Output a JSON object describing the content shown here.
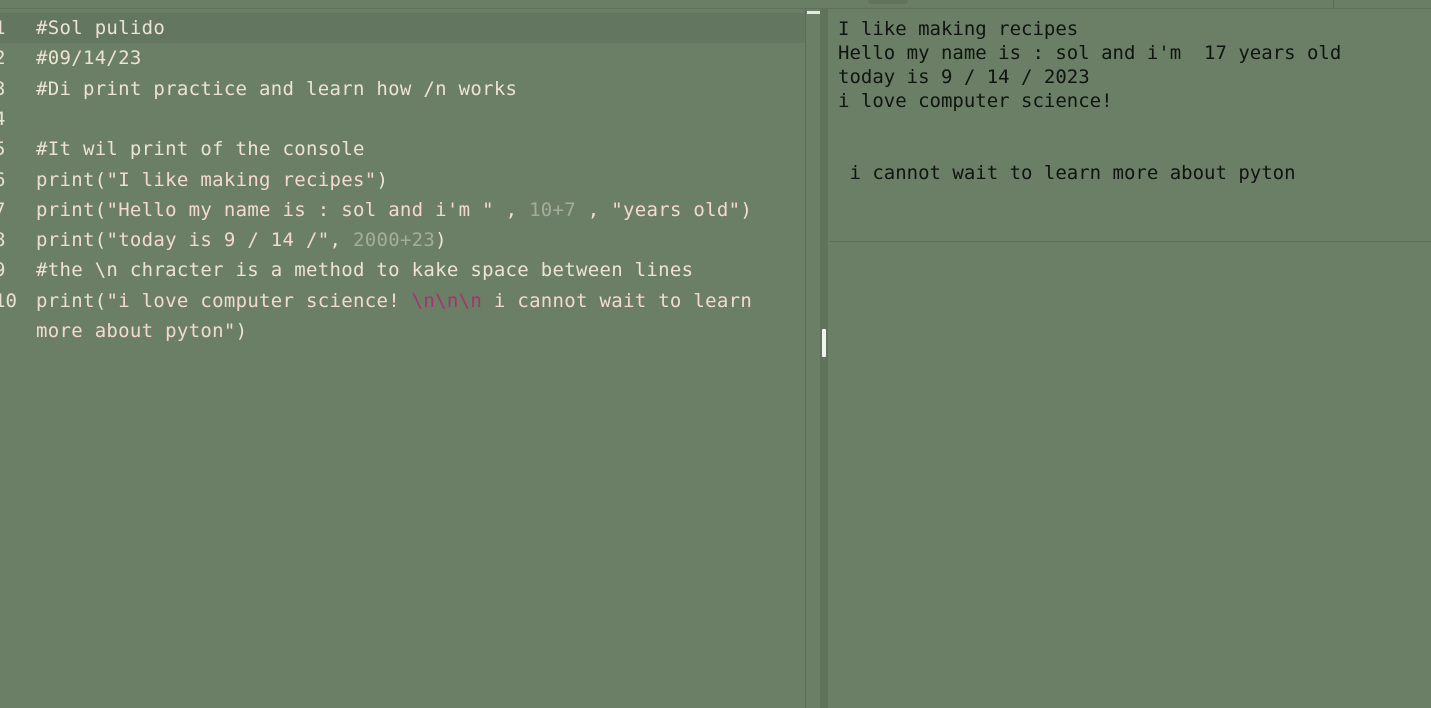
{
  "editor": {
    "lines": [
      {
        "num": "1",
        "segments": [
          {
            "cls": "cmt",
            "text": "#Sol pulido"
          }
        ]
      },
      {
        "num": "2",
        "segments": [
          {
            "cls": "cmt",
            "text": "#09/14/23"
          }
        ]
      },
      {
        "num": "3",
        "segments": [
          {
            "cls": "cmt",
            "text": "#Di print practice and learn how /n works"
          }
        ]
      },
      {
        "num": "4",
        "segments": []
      },
      {
        "num": "5",
        "segments": [
          {
            "cls": "cmt",
            "text": "#It wil print of the console"
          }
        ]
      },
      {
        "num": "6",
        "segments": [
          {
            "cls": "fn",
            "text": "print"
          },
          {
            "cls": "punc",
            "text": "("
          },
          {
            "cls": "str",
            "text": "\"I like making recipes\""
          },
          {
            "cls": "punc",
            "text": ")"
          }
        ]
      },
      {
        "num": "7",
        "segments": [
          {
            "cls": "fn",
            "text": "print"
          },
          {
            "cls": "punc",
            "text": "("
          },
          {
            "cls": "str",
            "text": "\"Hello my name is : sol and i'm \""
          },
          {
            "cls": "punc",
            "text": " , "
          },
          {
            "cls": "num",
            "text": "10+7"
          },
          {
            "cls": "punc",
            "text": " , "
          },
          {
            "cls": "str",
            "text": "\"years old\""
          },
          {
            "cls": "punc",
            "text": ")"
          }
        ]
      },
      {
        "num": "8",
        "segments": [
          {
            "cls": "fn",
            "text": "print"
          },
          {
            "cls": "punc",
            "text": "("
          },
          {
            "cls": "str",
            "text": "\"today is 9 / 14 /\""
          },
          {
            "cls": "punc",
            "text": ", "
          },
          {
            "cls": "num",
            "text": "2000+23"
          },
          {
            "cls": "punc",
            "text": ")"
          }
        ]
      },
      {
        "num": "9",
        "segments": [
          {
            "cls": "cmt",
            "text": "#the \\n chracter is a method to kake space between lines"
          }
        ]
      },
      {
        "num": "10",
        "segments": [
          {
            "cls": "fn",
            "text": "print"
          },
          {
            "cls": "punc",
            "text": "("
          },
          {
            "cls": "str",
            "text": "\"i love computer science! "
          },
          {
            "cls": "esc",
            "text": "\\n\\n\\n"
          },
          {
            "cls": "str",
            "text": " i cannot wait to learn"
          }
        ]
      },
      {
        "num": "",
        "segments": [
          {
            "cls": "str",
            "text": "more about pyton\""
          },
          {
            "cls": "punc",
            "text": ")"
          }
        ]
      }
    ]
  },
  "console": {
    "output": [
      "I like making recipes",
      "Hello my name is : sol and i'm  17 years old",
      "today is 9 / 14 / 2023",
      "i love computer science!",
      "",
      "",
      " i cannot wait to learn more about pyton"
    ]
  }
}
